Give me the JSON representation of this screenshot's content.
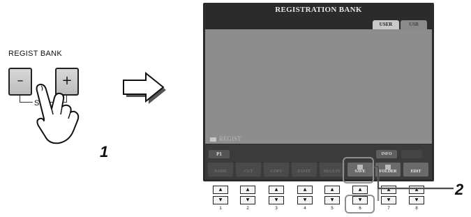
{
  "panel": {
    "label": "REGIST BANK",
    "minus_symbol": "–",
    "plus_symbol": "+",
    "sel_label": "SEL"
  },
  "steps": {
    "step1": "1",
    "step2": "2"
  },
  "screen": {
    "title": "REGISTRATION BANK",
    "tabs": [
      {
        "label": "USER"
      },
      {
        "label": "USB"
      }
    ],
    "folder_label": "REGIST",
    "page_label": "P1",
    "info_label": "INFO",
    "functions": [
      {
        "label": "NAME"
      },
      {
        "label": "CUT"
      },
      {
        "label": "COPY"
      },
      {
        "label": "PASTE"
      },
      {
        "label": "DELETE"
      },
      {
        "label": "SAVE"
      },
      {
        "label": "FOLDER"
      },
      {
        "label": "EDIT"
      }
    ]
  },
  "buttons": {
    "up_symbol": "▲",
    "down_symbol": "▼",
    "numbers": [
      "1",
      "2",
      "3",
      "4",
      "5",
      "6",
      "7",
      "8"
    ]
  },
  "colors": {
    "screen_bg": "#2b2b2b",
    "content_bg": "#8d8d8d",
    "highlight": "#8e8e8e"
  }
}
